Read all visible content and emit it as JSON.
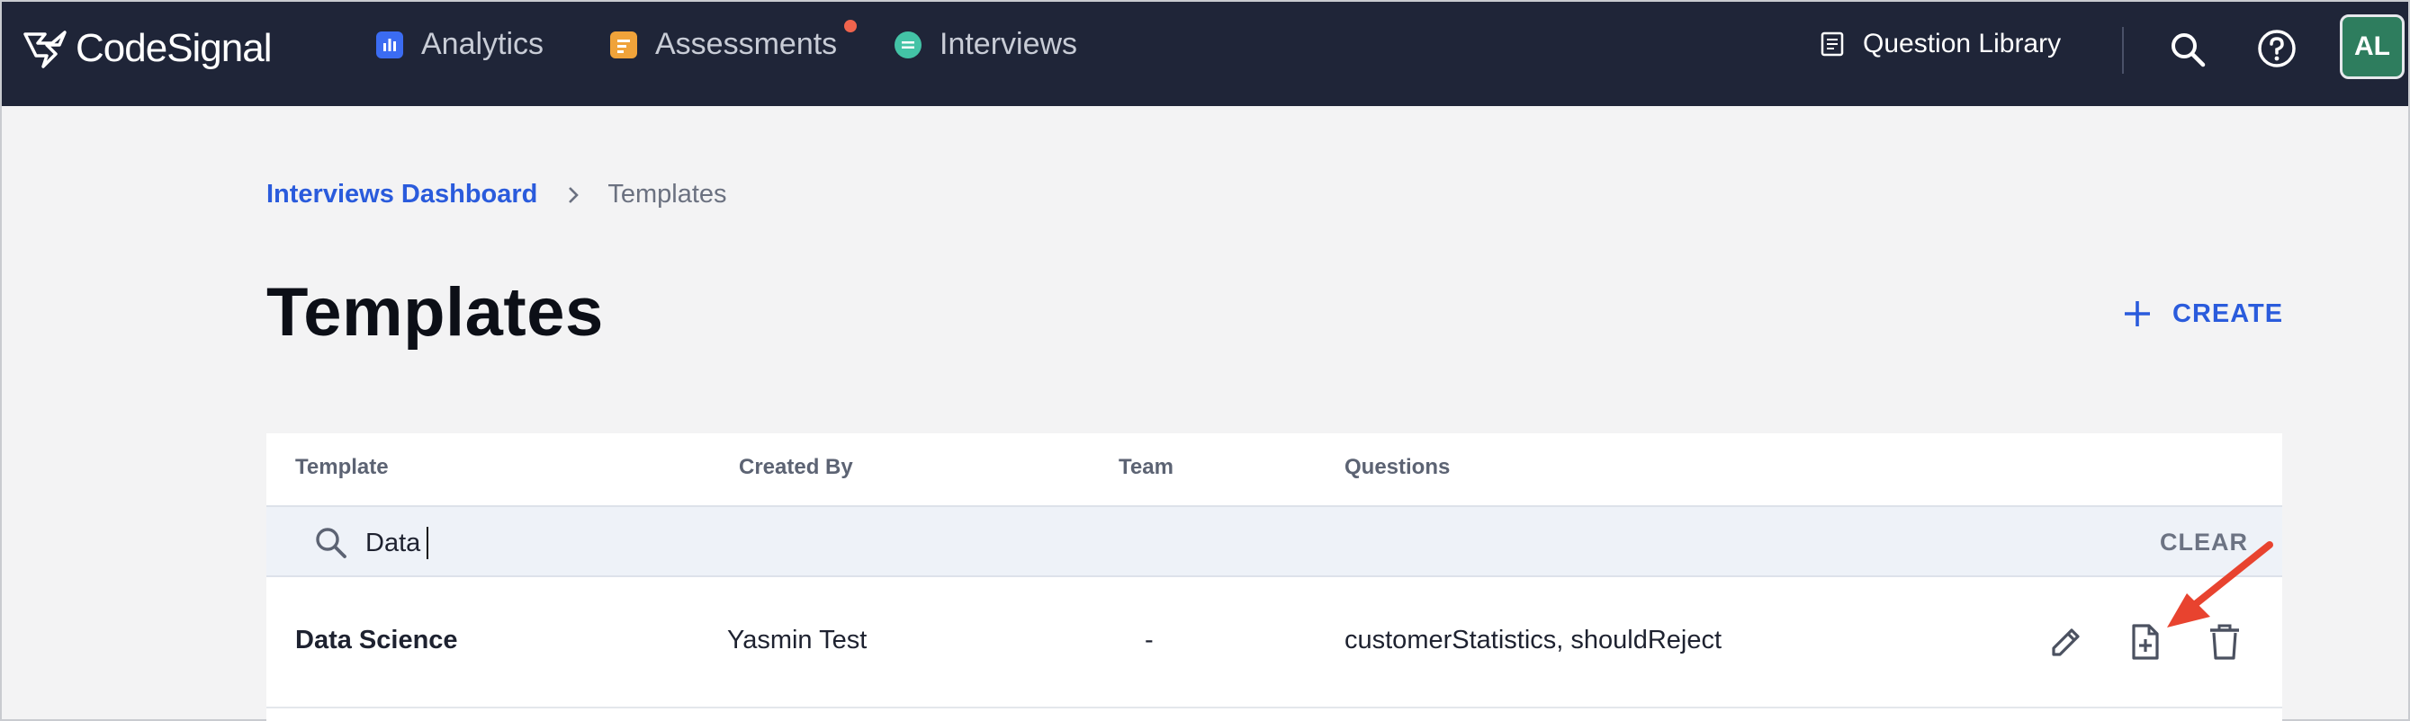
{
  "brand": {
    "name": "CodeSignal"
  },
  "nav": {
    "items": [
      {
        "label": "Analytics",
        "icon": "analytics-icon",
        "color": "#3b6cf2"
      },
      {
        "label": "Assessments",
        "icon": "assessments-icon",
        "color": "#f0a33a",
        "has_notification": true
      },
      {
        "label": "Interviews",
        "icon": "interviews-icon",
        "color": "#43c3a6"
      }
    ],
    "question_library": "Question Library",
    "avatar_initials": "AL",
    "notification_color": "#f0644d"
  },
  "breadcrumb": {
    "parent": "Interviews Dashboard",
    "current": "Templates"
  },
  "page": {
    "title": "Templates",
    "create_label": "CREATE"
  },
  "table": {
    "columns": [
      "Template",
      "Created By",
      "Team",
      "Questions"
    ],
    "filter": {
      "value": "Data",
      "clear_label": "CLEAR"
    },
    "rows": [
      {
        "template": "Data Science",
        "created_by": "Yasmin Test",
        "team": "-",
        "questions": "customerStatistics, shouldReject",
        "actions": [
          "edit-icon",
          "duplicate-icon",
          "delete-icon"
        ]
      }
    ]
  },
  "colors": {
    "nav_bg": "#1f2538",
    "accent": "#2a5bdc",
    "page_bg": "#f3f3f4",
    "annotation_arrow": "#e8432f"
  }
}
